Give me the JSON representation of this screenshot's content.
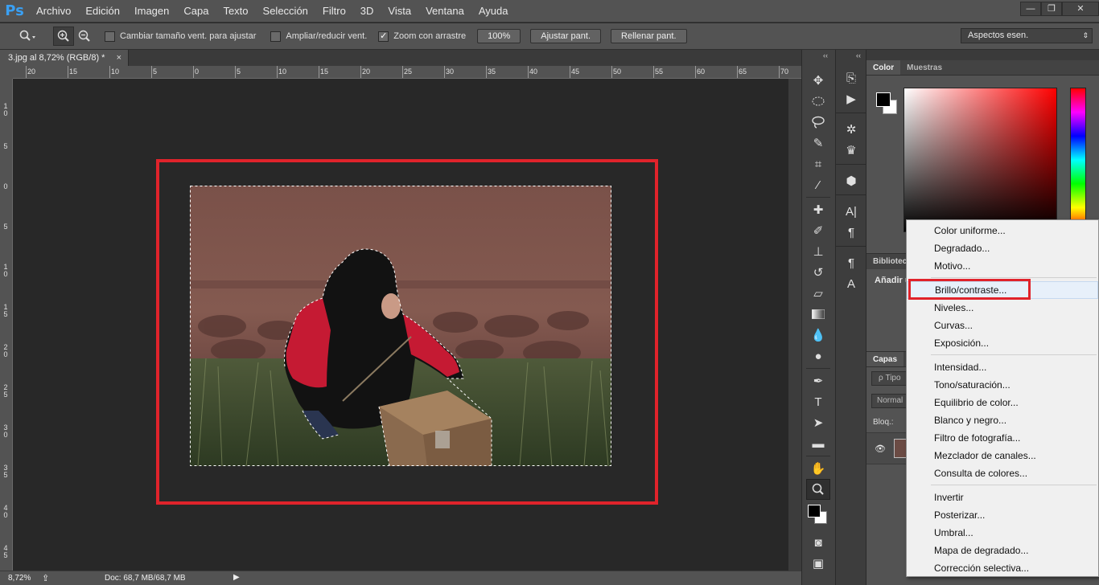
{
  "app": {
    "logo": "Ps"
  },
  "menubar": {
    "items": [
      "Archivo",
      "Edición",
      "Imagen",
      "Capa",
      "Texto",
      "Selección",
      "Filtro",
      "3D",
      "Vista",
      "Ventana",
      "Ayuda"
    ],
    "window_controls": {
      "minimize": "—",
      "restore": "❐",
      "close": "✕"
    }
  },
  "options_bar": {
    "resize_windows_label": "Cambiar tamaño vent. para ajustar",
    "resize_windows_checked": false,
    "zoom_all_label": "Ampliar/reducir vent.",
    "zoom_all_checked": false,
    "scrubby_zoom_label": "Zoom con arrastre",
    "scrubby_zoom_checked": true,
    "zoom_100_label": "100%",
    "fit_screen_label": "Ajustar pant.",
    "fill_screen_label": "Rellenar pant.",
    "workspace": "Aspectos esen."
  },
  "document": {
    "tab_title": "3.jpg al 8,72% (RGB/8) *",
    "tab_close": "×",
    "ruler_top": [
      "20",
      "15",
      "10",
      "5",
      "0",
      "5",
      "10",
      "15",
      "20",
      "25",
      "30",
      "35",
      "40",
      "45",
      "50",
      "55",
      "60",
      "65",
      "70"
    ],
    "ruler_left": [
      "1\n0",
      "5",
      "0",
      "5",
      "1\n0",
      "1\n5",
      "2\n0",
      "2\n5",
      "3\n0",
      "3\n5",
      "4\n0",
      "4\n5"
    ]
  },
  "statusbar": {
    "zoom": "8,72%",
    "doc_info": "Doc: 68,7 MB/68,7 MB",
    "arrow": "▶"
  },
  "panels": {
    "collapse": "‹‹",
    "color_tab": "Color",
    "swatches_tab": "Muestras",
    "library_tab": "Bibliotec",
    "library_add": "Añadir u",
    "layers_tab": "Capas",
    "layers_search": "ρ Tipo",
    "blend_mode": "Normal",
    "lock_label": "Bloq.:"
  },
  "adjustment_menu": {
    "groups": [
      [
        "Color uniforme...",
        "Degradado...",
        "Motivo..."
      ],
      [
        "Brillo/contraste...",
        "Niveles...",
        "Curvas...",
        "Exposición..."
      ],
      [
        "Intensidad...",
        "Tono/saturación...",
        "Equilibrio de color...",
        "Blanco y negro...",
        "Filtro de fotografía...",
        "Mezclador de canales...",
        "Consulta de colores..."
      ],
      [
        "Invertir",
        "Posterizar...",
        "Umbral...",
        "Mapa de degradado...",
        "Corrección selectiva..."
      ]
    ],
    "hovered_item": "Brillo/contraste..."
  },
  "colors": {
    "accent_red": "#e0232b",
    "ps_blue": "#3aa0f3",
    "menu_bg": "#f0f0f0",
    "ui_gray": "#535353"
  }
}
